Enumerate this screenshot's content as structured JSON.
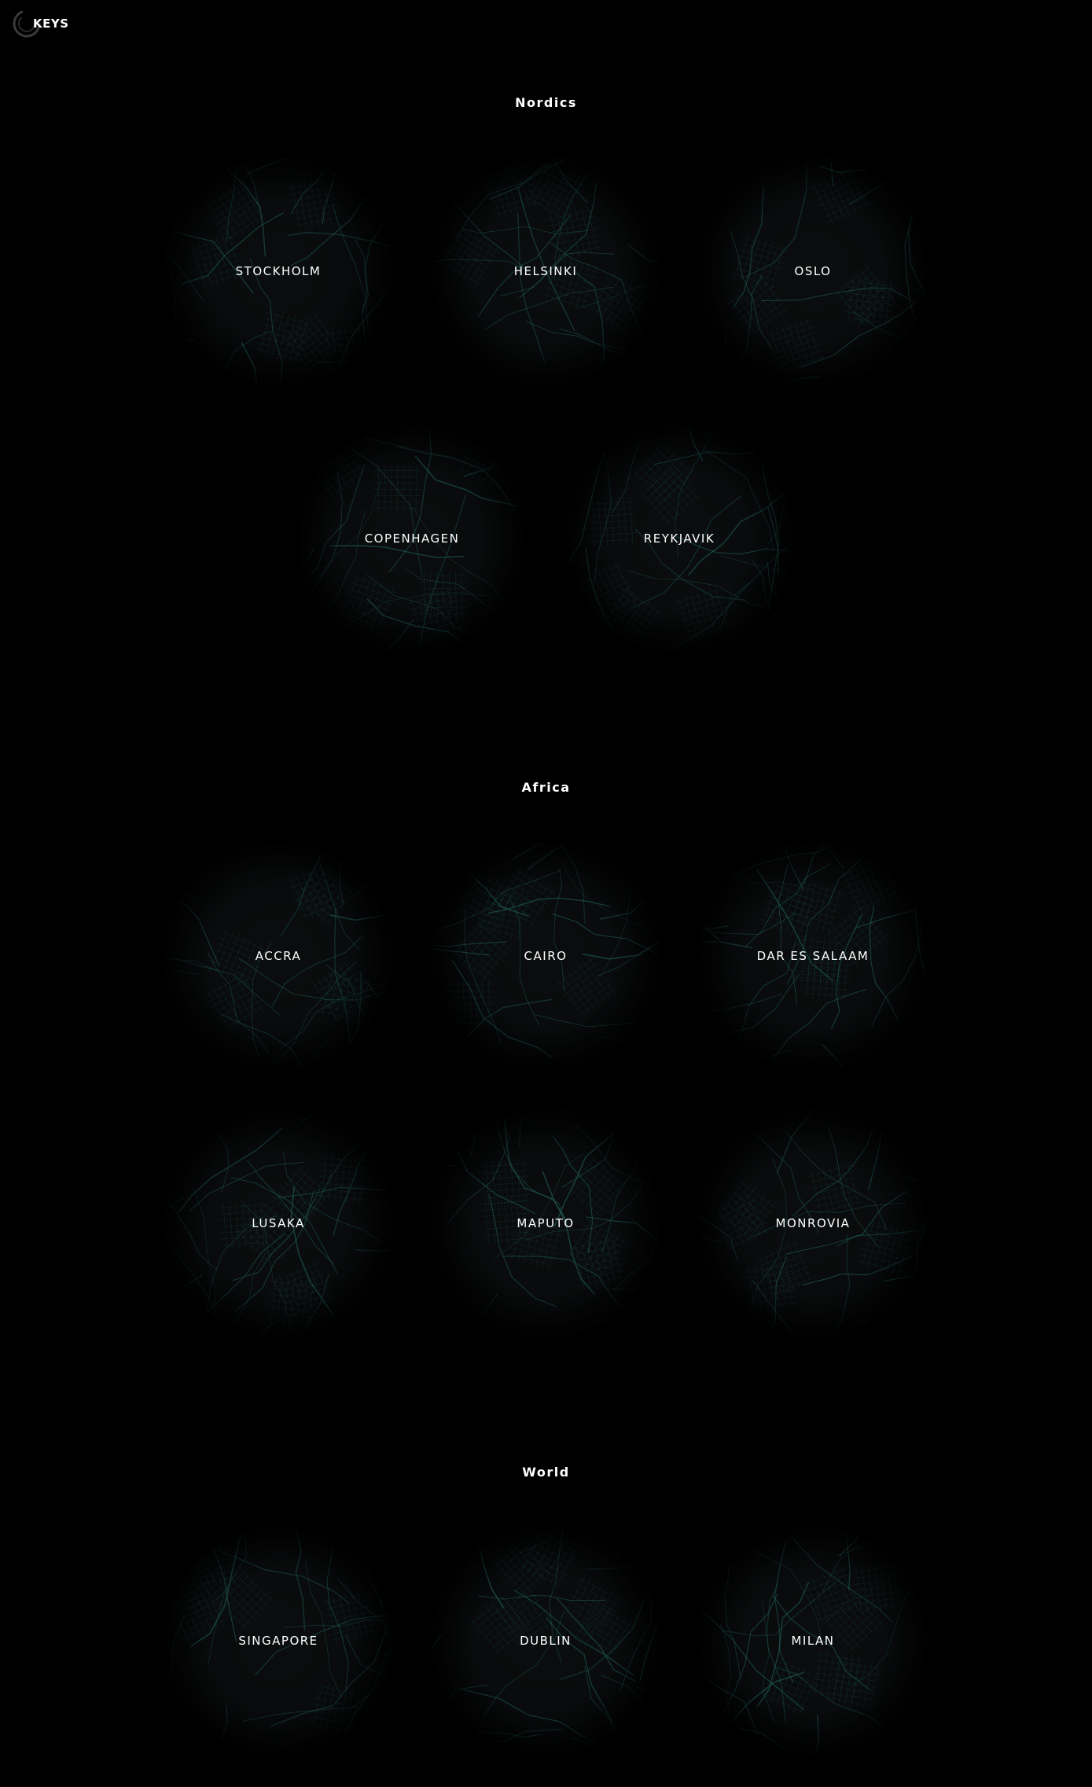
{
  "logo": {
    "text": "KEYS",
    "icon": "ring-logo-icon"
  },
  "accent": "#1f5a55",
  "sections": [
    {
      "title": "Nordics",
      "cities": [
        "STOCKHOLM",
        "HELSINKI",
        "OSLO",
        "COPENHAGEN",
        "REYKJAVIK"
      ]
    },
    {
      "title": "Africa",
      "cities": [
        "ACCRA",
        "CAIRO",
        "DAR ES SALAAM",
        "LUSAKA",
        "MAPUTO",
        "MONROVIA"
      ]
    },
    {
      "title": "World",
      "cities": [
        "SINGAPORE",
        "DUBLIN",
        "MILAN"
      ]
    }
  ]
}
